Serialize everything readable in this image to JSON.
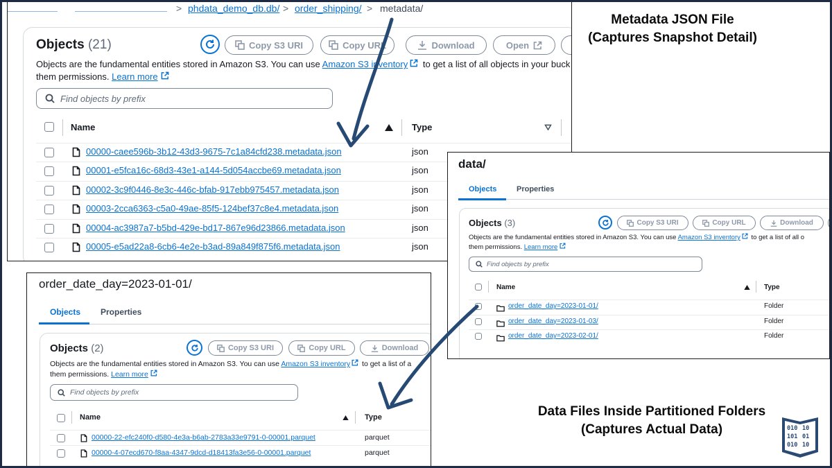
{
  "brand": {
    "primary": "#0972d3",
    "arrow": "#264a73",
    "frame": "#1f2a44"
  },
  "annotations": {
    "metadata_caption_line1": "Metadata JSON File",
    "metadata_caption_line2": "(Captures Snapshot Detail)",
    "data_caption_line1": "Data Files Inside Partitioned Folders",
    "data_caption_line2": "(Captures Actual Data)",
    "logo_icon": "binary-book-icon"
  },
  "metadata_panel": {
    "breadcrumb": {
      "separator": ">",
      "items": [
        "phdata_demo_db.db/",
        "order_shipping/",
        "metadata/"
      ]
    },
    "objects_title": "Objects",
    "objects_count": "(21)",
    "buttons": {
      "copy_s3_uri": "Copy S3 URI",
      "copy_url": "Copy URL",
      "download": "Download",
      "open": "Open"
    },
    "description_prefix": "Objects are the fundamental entities stored in Amazon S3. You can use",
    "inventory_link": "Amazon S3 inventory",
    "description_suffix": "to get a list of all objects in your buck",
    "description_line2": "them permissions.",
    "learn_more": "Learn more",
    "search_placeholder": "Find objects by prefix",
    "columns": {
      "name": "Name",
      "type": "Type"
    },
    "rows": [
      {
        "name": "00000-caee596b-3b12-43d3-9675-7c1a84cfd238.metadata.json",
        "type": "json"
      },
      {
        "name": "00001-e5fca16c-68d3-43e1-a144-5d054accbe69.metadata.json",
        "type": "json"
      },
      {
        "name": "00002-3c9f0446-8e3c-446c-bfab-917ebb975457.metadata.json",
        "type": "json"
      },
      {
        "name": "00003-2cca6363-c5a0-49ae-85f5-124bef37c8e4.metadata.json",
        "type": "json"
      },
      {
        "name": "00004-ac3987a7-b5bd-429e-bd17-867e96d23866.metadata.json",
        "type": "json"
      },
      {
        "name": "00005-e5ad22a8-6cb6-4e2e-b3ad-89a849f875f6.metadata.json",
        "type": "json"
      }
    ]
  },
  "data_panel": {
    "heading": "data/",
    "tabs": [
      "Objects",
      "Properties"
    ],
    "objects_title": "Objects",
    "objects_count": "(3)",
    "buttons": {
      "copy_s3_uri": "Copy S3 URI",
      "copy_url": "Copy URL",
      "download": "Download"
    },
    "description_prefix": "Objects are the fundamental entities stored in Amazon S3. You can use",
    "inventory_link": "Amazon S3 inventory",
    "description_suffix": "to get a list of all o",
    "description_line2": "them permissions.",
    "learn_more": "Learn more",
    "search_placeholder": "Find objects by prefix",
    "columns": {
      "name": "Name",
      "type": "Type"
    },
    "rows": [
      {
        "name": "order_date_day=2023-01-01/",
        "type": "Folder"
      },
      {
        "name": "order_date_day=2023-01-03/",
        "type": "Folder"
      },
      {
        "name": "order_date_day=2023-02-01/",
        "type": "Folder"
      }
    ]
  },
  "partition_panel": {
    "heading": "order_date_day=2023-01-01/",
    "tabs": [
      "Objects",
      "Properties"
    ],
    "objects_title": "Objects",
    "objects_count": "(2)",
    "buttons": {
      "copy_s3_uri": "Copy S3 URI",
      "copy_url": "Copy URL",
      "download": "Download"
    },
    "description_prefix": "Objects are the fundamental entities stored in Amazon S3. You can use",
    "inventory_link": "Amazon S3 inventory",
    "description_suffix": "to get a list of a",
    "description_line2": "them permissions.",
    "learn_more": "Learn more",
    "search_placeholder": "Find objects by prefix",
    "columns": {
      "name": "Name",
      "type": "Type"
    },
    "rows": [
      {
        "name": "00000-22-efc240f0-d580-4e3a-b6ab-2783a33e9791-0-00001.parquet",
        "type": "parquet"
      },
      {
        "name": "00000-4-07ecd670-f8aa-4347-9dcd-d18413fa3e56-0-00001.parquet",
        "type": "parquet"
      }
    ]
  }
}
